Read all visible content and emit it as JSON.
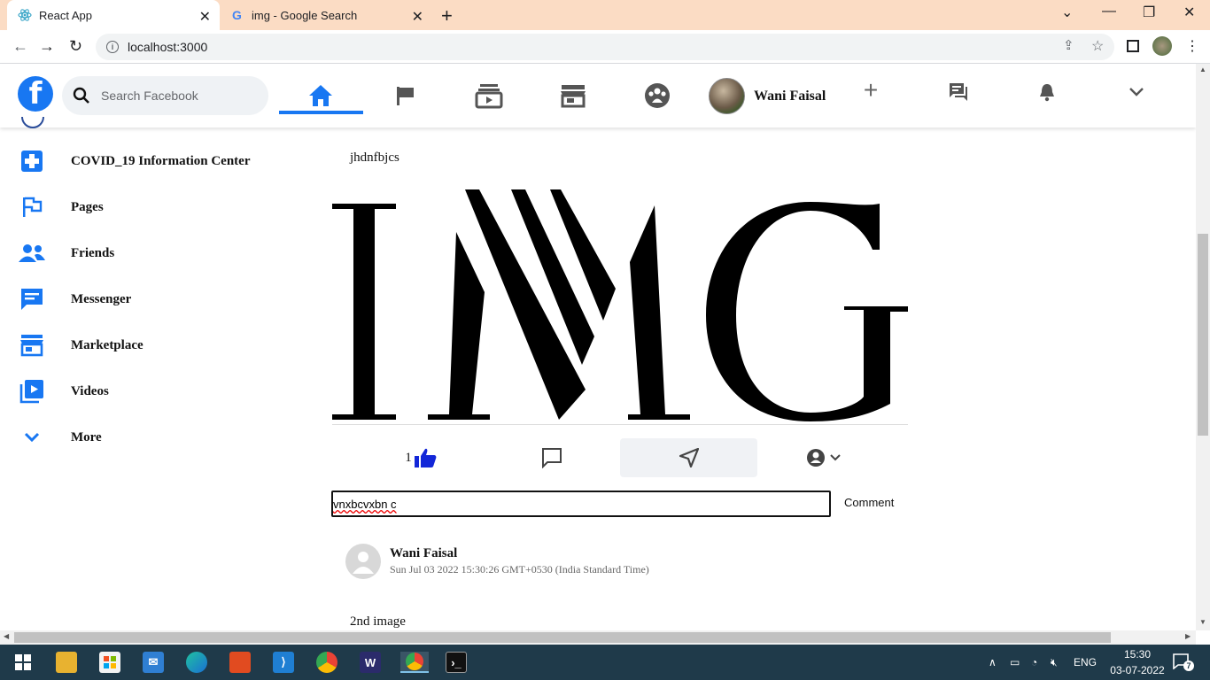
{
  "browser": {
    "tabs": [
      {
        "title": "React App",
        "active": true
      },
      {
        "title": "img - Google Search",
        "active": false
      }
    ],
    "url": "localhost:3000"
  },
  "header": {
    "search_placeholder": "Search Facebook",
    "profile_name": "Wani Faisal",
    "brand_color": "#1877f2"
  },
  "sidebar": {
    "items": [
      {
        "label": "COVID_19 Information Center",
        "icon": "plus-box-icon"
      },
      {
        "label": "Pages",
        "icon": "flag-icon"
      },
      {
        "label": "Friends",
        "icon": "people-icon"
      },
      {
        "label": "Messenger",
        "icon": "chat-icon"
      },
      {
        "label": "Marketplace",
        "icon": "store-icon"
      },
      {
        "label": "Videos",
        "icon": "video-icon"
      },
      {
        "label": "More",
        "icon": "chevron-down-icon"
      }
    ]
  },
  "post": {
    "text": "jhdnfbjcs",
    "image_text": "IMG",
    "like_count": "1",
    "comment_input_value": "vnxbcvxbn c",
    "comment_button": "Comment"
  },
  "comment": {
    "author": "Wani Faisal",
    "timestamp": "Sun Jul 03 2022 15:30:26 GMT+0530 (India Standard Time)"
  },
  "next_post": {
    "text": "2nd image"
  },
  "taskbar": {
    "language": "ENG",
    "time": "15:30",
    "date": "03-07-2022",
    "notification_count": "7"
  }
}
